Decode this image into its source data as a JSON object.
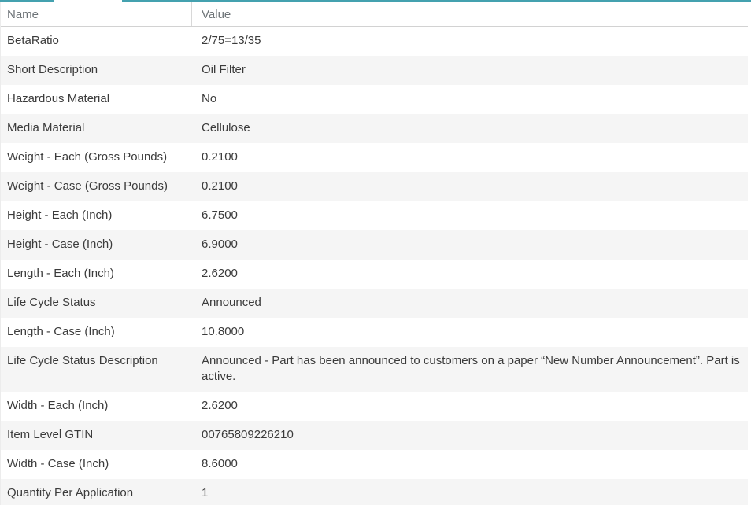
{
  "colors": {
    "accent_teal": "#44a1af",
    "alt_row_bg": "#f5f5f5",
    "header_text": "#6d7377",
    "body_text": "#3b3b3b"
  },
  "table": {
    "header": {
      "name_label": "Name",
      "value_label": "Value"
    },
    "rows": [
      {
        "name": "BetaRatio",
        "value": "2/75=13/35"
      },
      {
        "name": "Short Description",
        "value": "Oil Filter"
      },
      {
        "name": "Hazardous Material",
        "value": "No"
      },
      {
        "name": "Media Material",
        "value": "Cellulose"
      },
      {
        "name": "Weight - Each (Gross Pounds)",
        "value": "0.2100"
      },
      {
        "name": "Weight - Case (Gross Pounds)",
        "value": "0.2100"
      },
      {
        "name": "Height - Each (Inch)",
        "value": "6.7500"
      },
      {
        "name": "Height - Case (Inch)",
        "value": "6.9000"
      },
      {
        "name": "Length - Each (Inch)",
        "value": "2.6200"
      },
      {
        "name": "Life Cycle Status",
        "value": "Announced"
      },
      {
        "name": "Length - Case (Inch)",
        "value": "10.8000"
      },
      {
        "name": "Life Cycle Status Description",
        "value": "Announced - Part has been announced to customers on a paper “New Number Announcement”. Part is active."
      },
      {
        "name": "Width - Each (Inch)",
        "value": "2.6200"
      },
      {
        "name": "Item Level GTIN",
        "value": "00765809226210"
      },
      {
        "name": "Width - Case (Inch)",
        "value": "8.6000"
      },
      {
        "name": "Quantity Per Application",
        "value": "1"
      }
    ]
  }
}
